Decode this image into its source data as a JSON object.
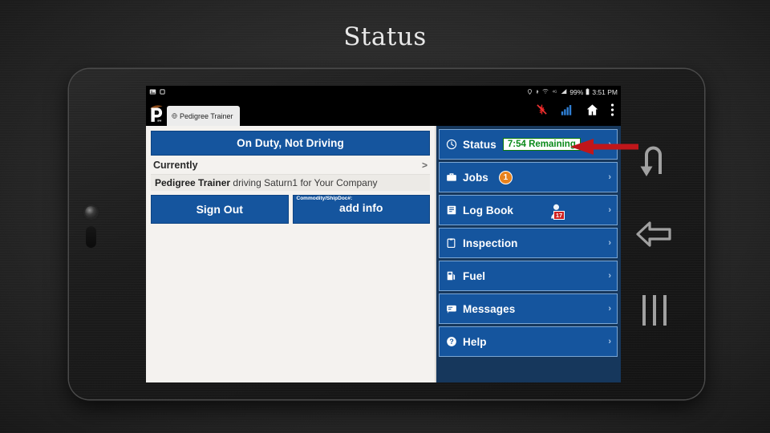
{
  "slide": {
    "title": "Status"
  },
  "device": {
    "camera_icon": "camera-lens",
    "side_button": "power-button"
  },
  "status_bar": {
    "left_icons": [
      "image-notification-icon",
      "copy-notification-icon"
    ],
    "right_icons": [
      "location-icon",
      "bluetooth-icon",
      "wifi-icon",
      "signal-alt-icon",
      "cellular-signal-icon",
      "battery-icon"
    ],
    "battery_percent": "99%",
    "clock": "3:51 PM"
  },
  "app_bar": {
    "logo_icon": "pedigree-p-logo",
    "tab": {
      "favicon": "globe-icon",
      "label": "Pedigree Trainer"
    },
    "actions": [
      {
        "name": "bluetooth-disabled-icon",
        "label": ""
      },
      {
        "name": "signal-bars-icon",
        "label": ""
      },
      {
        "name": "home-icon",
        "label": ""
      },
      {
        "name": "overflow-menu-icon",
        "label": ""
      }
    ]
  },
  "left_panel": {
    "duty_status": "On Duty, Not Driving",
    "currently_label": "Currently",
    "currently_chevron": ">",
    "driver_name": "Pedigree Trainer",
    "driver_activity": "driving Saturn1 for Your Company",
    "sign_out_label": "Sign Out",
    "add_info_caption": "Commodity/ShipDoc#:",
    "add_info_label": "add info"
  },
  "right_panel": {
    "menu": [
      {
        "label": "Status",
        "icon": "clock-icon",
        "badge": "7:54 Remaining",
        "badge_type": "remaining",
        "chevron": "›"
      },
      {
        "label": "Jobs",
        "icon": "briefcase-icon",
        "badge": "1",
        "badge_type": "count",
        "chevron": "›"
      },
      {
        "label": "Log Book",
        "icon": "book-icon",
        "badge": "17",
        "badge_type": "day",
        "chevron": "›"
      },
      {
        "label": "Inspection",
        "icon": "clipboard-icon",
        "badge": "",
        "badge_type": "none",
        "chevron": "›"
      },
      {
        "label": "Fuel",
        "icon": "fuel-pump-icon",
        "badge": "",
        "badge_type": "none",
        "chevron": "›"
      },
      {
        "label": "Messages",
        "icon": "message-icon",
        "badge": "",
        "badge_type": "none",
        "chevron": "›"
      },
      {
        "label": "Help",
        "icon": "help-circle-icon",
        "badge": "",
        "badge_type": "none",
        "chevron": "›"
      }
    ]
  },
  "annotation": {
    "arrow_color": "#c0161a",
    "points_to": "Status"
  },
  "nav_bar": {
    "items": [
      {
        "name": "undo-arrow-icon"
      },
      {
        "name": "back-arrow-icon"
      },
      {
        "name": "recent-apps-icon"
      }
    ]
  },
  "colors": {
    "primary_blue": "#15559e",
    "panel_blue": "#16375c",
    "panel_light": "#f4f2ef",
    "accent_orange": "#e8821e",
    "accent_green": "#0a8a1a",
    "accent_red": "#cf2020",
    "annotation_red": "#c0161a"
  }
}
